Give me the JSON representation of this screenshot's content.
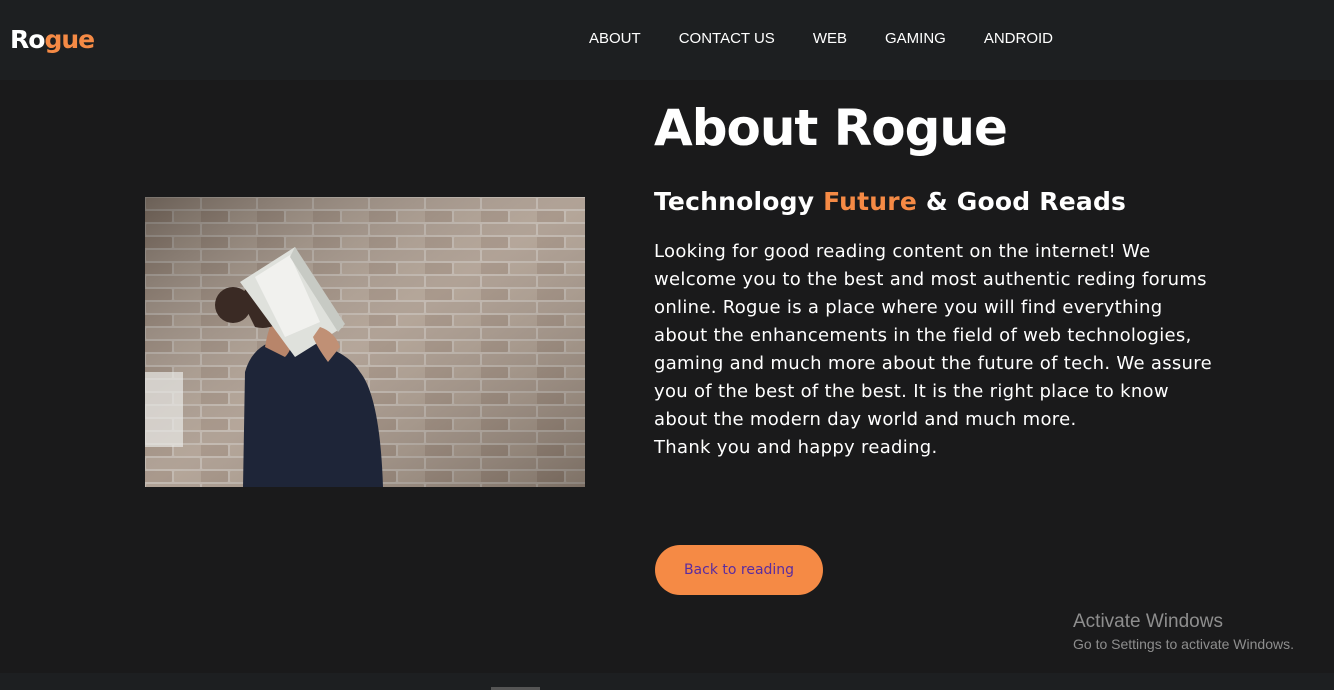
{
  "brand": {
    "logo_white": "Ro",
    "logo_orange": "gue"
  },
  "nav": {
    "items": [
      {
        "label": "ABOUT"
      },
      {
        "label": "CONTACT US"
      },
      {
        "label": "WEB"
      },
      {
        "label": "GAMING"
      },
      {
        "label": "ANDROID"
      }
    ]
  },
  "about": {
    "title": "About Rogue",
    "subtitle_part1": "Technology ",
    "subtitle_accent": "Future",
    "subtitle_part2": " & Good Reads",
    "body": "Looking for good reading content on the internet! We welcome you to the best and most authentic reding forums online. Rogue is a place where you will find everything about the enhancements in the field of web technologies, gaming and much more about the future of tech. We assure you of the best of the best. It is the right place to know about the modern day world and much more.",
    "closing": "Thank you and happy reading.",
    "button_label": "Back to reading"
  },
  "windows_watermark": {
    "line1": "Activate Windows",
    "line2": "Go to Settings to activate Windows."
  },
  "colors": {
    "accent": "#f58a45",
    "background": "#1a1a1b",
    "navbar": "#1d1f21",
    "button_text": "#5a2ca0"
  }
}
